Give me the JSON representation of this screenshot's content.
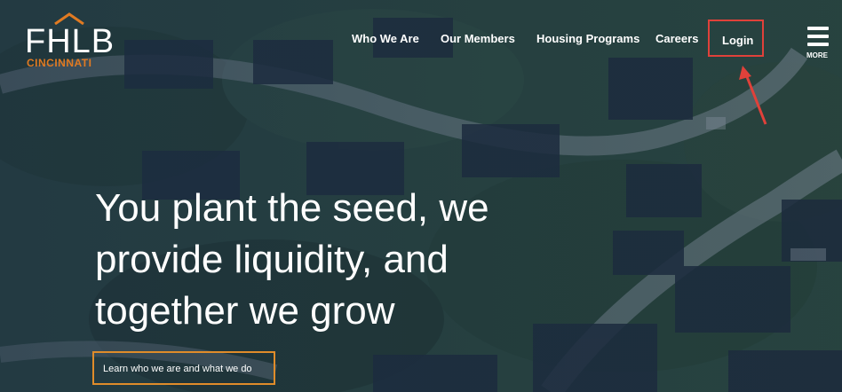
{
  "brand": {
    "name": "FHLB",
    "city": "CINCINNATI",
    "accent": "#e07a22"
  },
  "nav": {
    "items": [
      {
        "label": "Who We Are"
      },
      {
        "label": "Our Members"
      },
      {
        "label": "Housing Programs"
      },
      {
        "label": "Careers"
      }
    ],
    "login": "Login",
    "menu": "MORE",
    "highlight_color": "#e0413a"
  },
  "hero": {
    "lines": [
      "You plant the seed, we",
      "provide liquidity, and",
      "together we grow"
    ],
    "cta": "Learn who we are and what we do",
    "cta_border": "#e08c2a"
  }
}
